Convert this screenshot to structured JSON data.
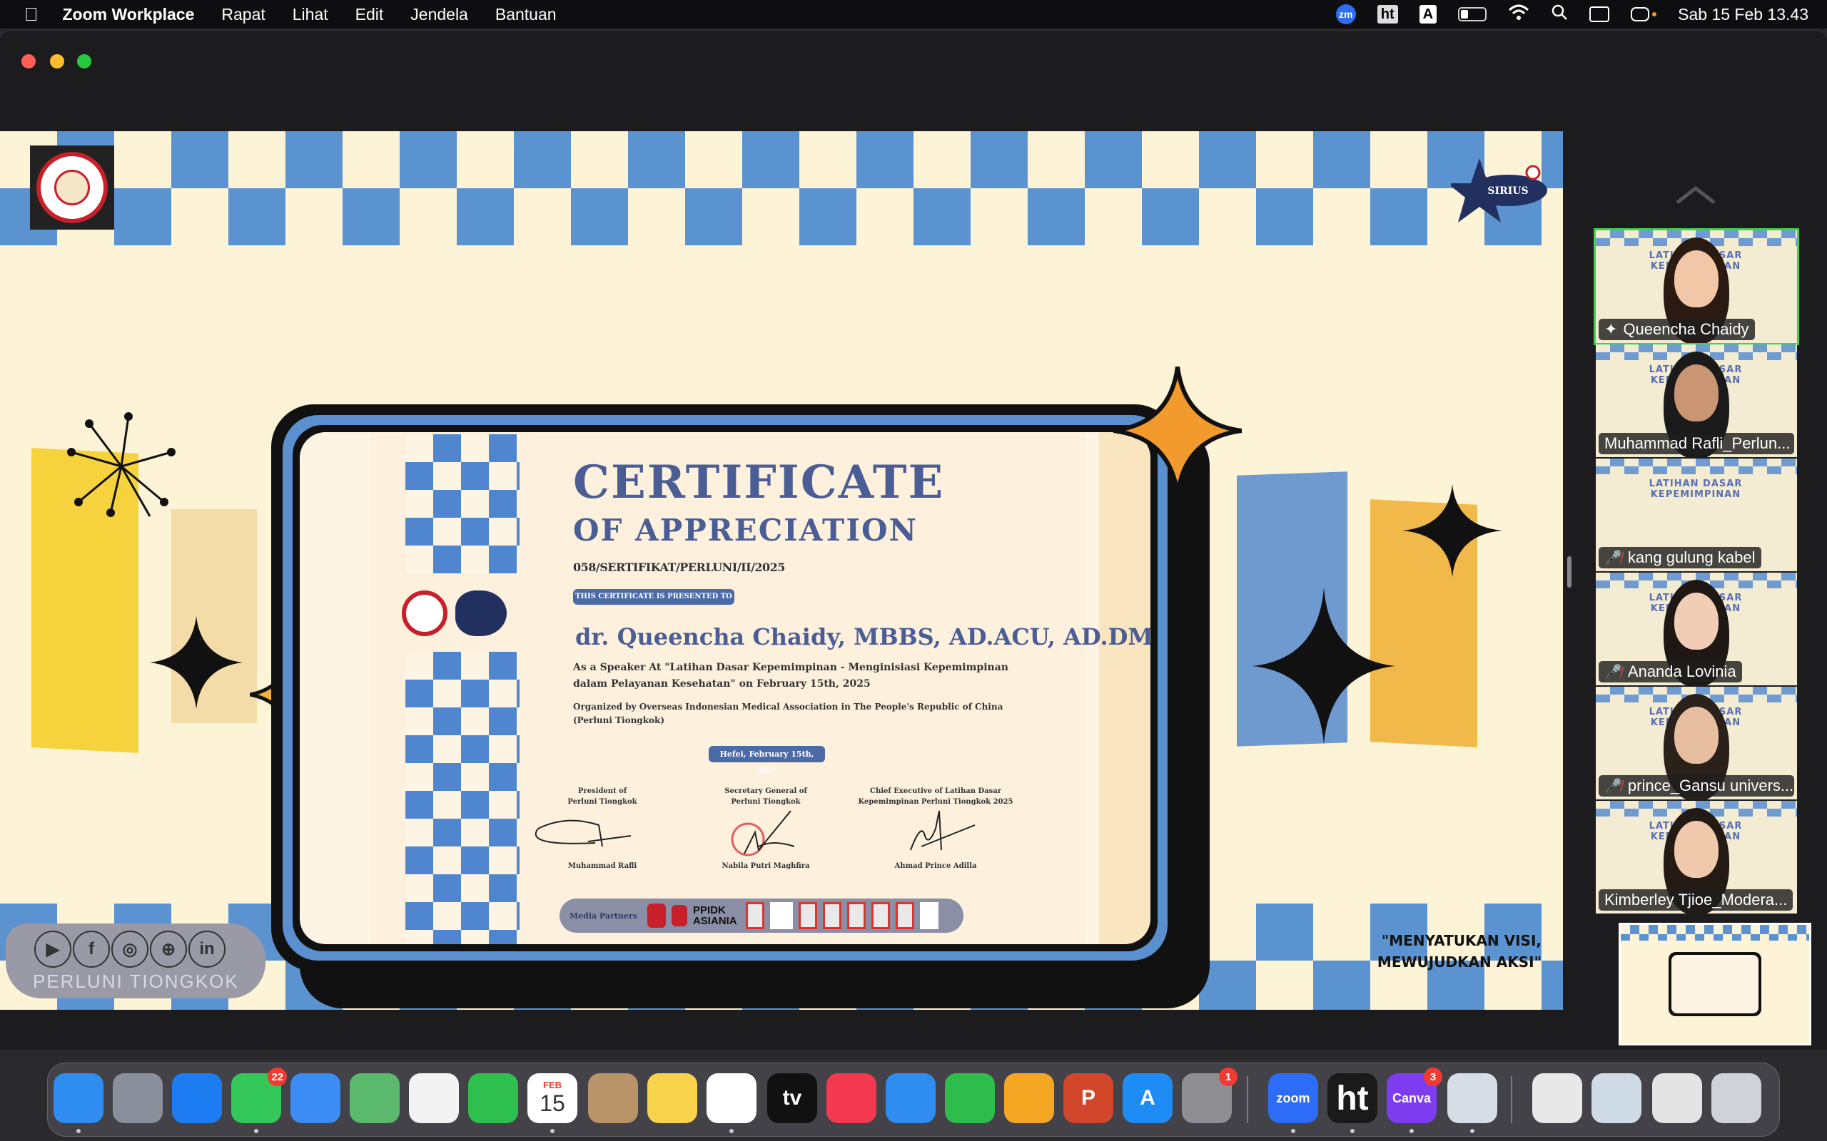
{
  "menubar": {
    "app_name": "Zoom Workplace",
    "items": [
      "Rapat",
      "Lihat",
      "Edit",
      "Jendela",
      "Bantuan"
    ],
    "status": {
      "zm": "zm",
      "ht": "ht",
      "input": "A",
      "datetime": "Sab 15 Feb 13.43"
    }
  },
  "slide": {
    "certificate": {
      "title": "CERTIFICATE",
      "subtitle": "OF APPRECIATION",
      "number": "058/SERTIFIKAT/PERLUNI/II/2025",
      "presented_to": "THIS CERTIFICATE IS PRESENTED TO",
      "recipient": "dr. Queencha Chaidy, MBBS, AD.ACU, AD.DMC",
      "description_1": "As a Speaker At \"Latihan Dasar Kepemimpinan - Menginisiasi Kepemimpinan",
      "description_2": "dalam Pelayanan Kesehatan\" on February 15th, 2025",
      "organized_1": "Organized by Overseas Indonesian Medical Association in The People's Republic of China",
      "organized_2": "(Perluni Tiongkok)",
      "place_date": "Hefei, February 15th, 2025",
      "signatories": [
        {
          "title_1": "President of",
          "title_2": "Perluni Tiongkok",
          "name": "Muhammad Rafli"
        },
        {
          "title_1": "Secretary General of",
          "title_2": "Perluni Tiongkok",
          "name": "Nabila Putri Maghfira"
        },
        {
          "title_1": "Chief Executive of Latihan Dasar",
          "title_2": "Kepemimpinan Perluni Tiongkok 2025",
          "name": "Ahmad Prince Adilla"
        }
      ],
      "media_partners_label": "Media Partners",
      "media_partner_logo": "PPIDK ASIANIA"
    },
    "social_label": "PERLUNI TIONGKOK",
    "social_icons": [
      "youtube-icon",
      "facebook-icon",
      "instagram-icon",
      "dribbble-icon",
      "linkedin-icon"
    ],
    "quote_1": "\"MENYATUKAN VISI,",
    "quote_2": "MEWUJUDKAN AKSI\"",
    "logo_left": "PERLUNI",
    "logo_right": "KABINET SIRIUS"
  },
  "participants": [
    {
      "name": "Queencha Chaidy",
      "status": "speaking",
      "video": true,
      "muted": false
    },
    {
      "name": "Muhammad Rafli_Perlun...",
      "video": true,
      "muted": false
    },
    {
      "name": "kang gulung kabel",
      "video": false,
      "muted": true
    },
    {
      "name": "Ananda Lovinia",
      "video": true,
      "muted": true
    },
    {
      "name": "prince_Gansu univers...",
      "video": true,
      "muted": true
    },
    {
      "name": "Kimberley Tjioe_Modera...",
      "video": true,
      "muted": false
    }
  ],
  "participant_tile_title": "LATIHAN DASAR KEPEMIMPINAN",
  "dock": {
    "apps": [
      {
        "name": "finder",
        "color": "#2f8cf0"
      },
      {
        "name": "launchpad",
        "color": "#8a8f9c"
      },
      {
        "name": "safari",
        "color": "#1e7cf2"
      },
      {
        "name": "messages",
        "color": "#34c759",
        "badge": "22"
      },
      {
        "name": "mail",
        "color": "#3b8df5"
      },
      {
        "name": "maps",
        "color": "#5ab96c"
      },
      {
        "name": "photos",
        "color": "#f3f3f3"
      },
      {
        "name": "facetime",
        "color": "#2fbf4f"
      },
      {
        "name": "calendar",
        "color": "#ffffff",
        "month": "FEB",
        "day": "15"
      },
      {
        "name": "contacts",
        "color": "#b89468"
      },
      {
        "name": "notes",
        "color": "#f8d24a"
      },
      {
        "name": "freeform",
        "color": "#ffffff"
      },
      {
        "name": "apple-tv",
        "color": "#111111",
        "label": "tv"
      },
      {
        "name": "music",
        "color": "#f4384f"
      },
      {
        "name": "keynote",
        "color": "#2f8cf0"
      },
      {
        "name": "numbers",
        "color": "#2ebd4c"
      },
      {
        "name": "pages",
        "color": "#f5a623"
      },
      {
        "name": "powerpoint",
        "color": "#d2472b",
        "label": "P"
      },
      {
        "name": "app-store",
        "color": "#1e8cf5",
        "label": "A"
      },
      {
        "name": "system-settings",
        "color": "#8e8e93",
        "badge": "1"
      },
      {
        "name": "zoom",
        "color": "#2d6cf6",
        "label": "zoom"
      },
      {
        "name": "ht",
        "color": "#1a1a1a",
        "label": "ht"
      },
      {
        "name": "canva",
        "color": "#7d3cf0",
        "label": "Canva",
        "badge": "3"
      },
      {
        "name": "preview",
        "color": "#d6dde6"
      },
      {
        "name": "recent-window-1",
        "color": "#e8e8e8"
      },
      {
        "name": "recent-window-2",
        "color": "#d0dbe8"
      },
      {
        "name": "recent-window-3",
        "color": "#e4e4e4"
      },
      {
        "name": "trash",
        "color": "#cfd2d6"
      }
    ]
  }
}
